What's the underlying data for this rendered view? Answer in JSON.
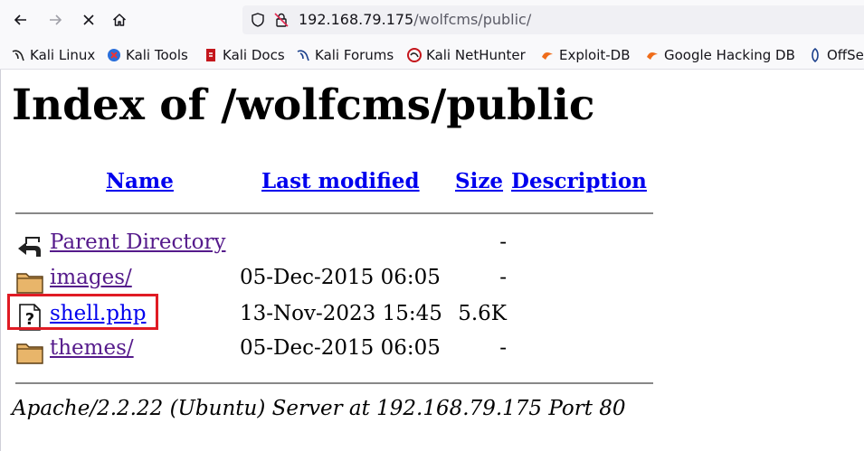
{
  "browser": {
    "url_host": "192.168.79.175",
    "url_path": "/wolfcms/public/",
    "bookmarks": [
      {
        "label": "Kali Linux",
        "icon": "kali-dragon-icon"
      },
      {
        "label": "Kali Tools",
        "icon": "kali-tools-icon"
      },
      {
        "label": "Kali Docs",
        "icon": "kali-docs-icon"
      },
      {
        "label": "Kali Forums",
        "icon": "kali-forums-icon"
      },
      {
        "label": "Kali NetHunter",
        "icon": "kali-nethunter-icon"
      },
      {
        "label": "Exploit-DB",
        "icon": "exploit-db-icon"
      },
      {
        "label": "Google Hacking DB",
        "icon": "ghdb-icon"
      },
      {
        "label": "OffSe",
        "icon": "offsec-icon"
      }
    ]
  },
  "page": {
    "title": "Index of /wolfcms/public",
    "columns": {
      "name": "Name",
      "modified": "Last modified",
      "size": "Size",
      "description": "Description"
    },
    "rows": [
      {
        "name": "Parent Directory",
        "modified": "",
        "size": "-",
        "icon": "back-arrow-icon"
      },
      {
        "name": "images/",
        "modified": "05-Dec-2015 06:05",
        "size": "-",
        "icon": "folder-icon"
      },
      {
        "name": "shell.php",
        "modified": "13-Nov-2023 15:45",
        "size": "5.6K",
        "icon": "unknown-file-icon"
      },
      {
        "name": "themes/",
        "modified": "05-Dec-2015 06:05",
        "size": "-",
        "icon": "folder-icon"
      }
    ],
    "server_signature": "Apache/2.2.22 (Ubuntu) Server at 192.168.79.175 Port 80"
  },
  "colors": {
    "link_visited": "#551a8b",
    "link_unvisited": "#0000ee",
    "highlight": "#e01b24"
  }
}
